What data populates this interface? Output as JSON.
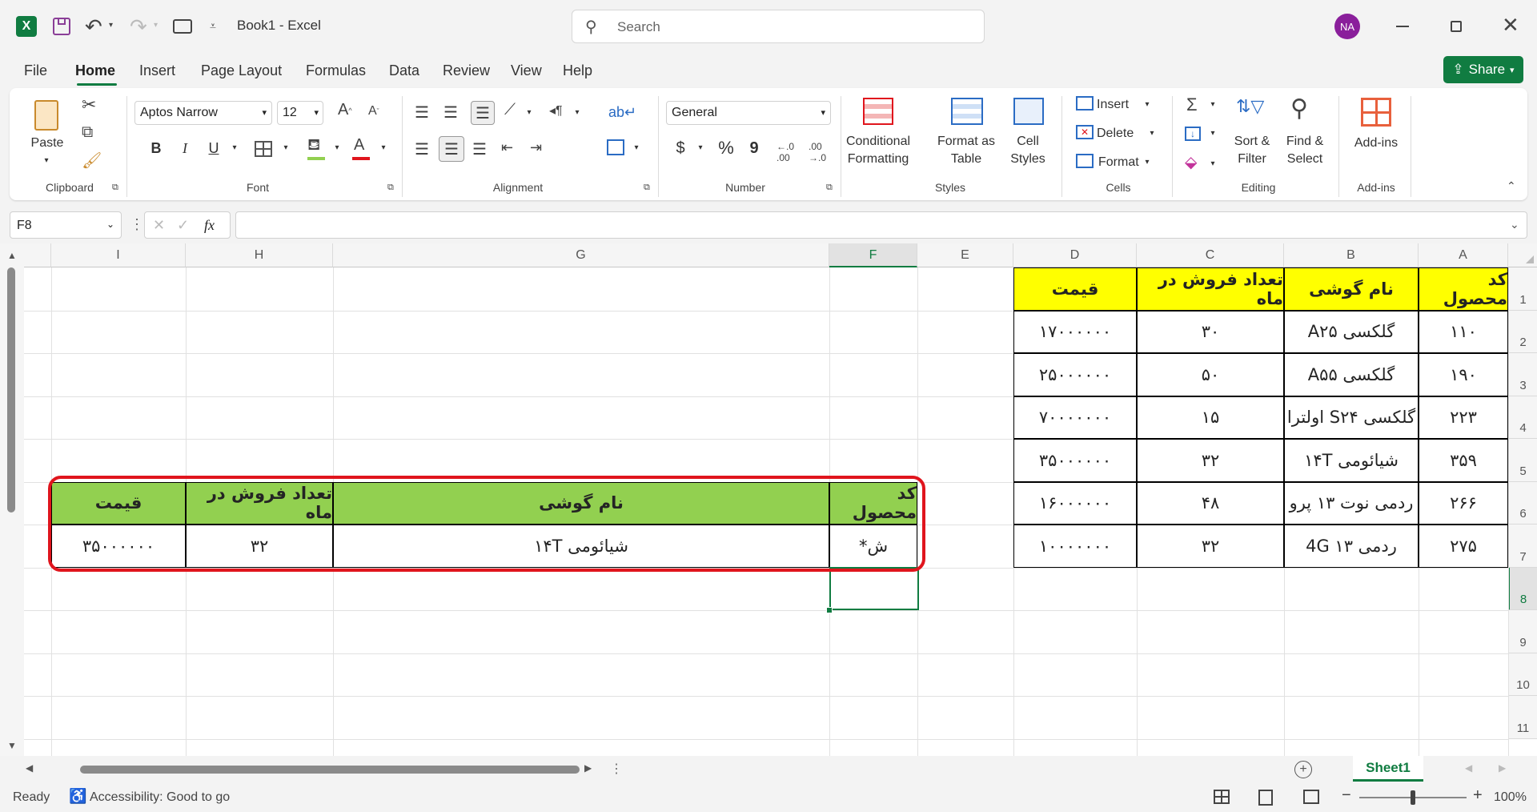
{
  "window": {
    "app_icon": "excel-icon",
    "title": "Book1 - Excel",
    "search_placeholder": "Search",
    "avatar_initials": "NA"
  },
  "menu": {
    "tabs": [
      "File",
      "Home",
      "Insert",
      "Page Layout",
      "Formulas",
      "Data",
      "Review",
      "View",
      "Help"
    ],
    "active": "Home",
    "share_label": "Share"
  },
  "ribbon": {
    "clipboard": {
      "label": "Clipboard",
      "paste": "Paste"
    },
    "font": {
      "label": "Font",
      "family": "Aptos Narrow",
      "size": "12",
      "bold": "B",
      "italic": "I",
      "underline": "U"
    },
    "alignment": {
      "label": "Alignment"
    },
    "number": {
      "label": "Number",
      "format": "General",
      "currency": "$",
      "percent": "%",
      "comma": "9"
    },
    "styles": {
      "label": "Styles",
      "conditional": [
        "Conditional",
        "Formatting"
      ],
      "format_table": [
        "Format as",
        "Table"
      ],
      "cell_styles": [
        "Cell",
        "Styles"
      ]
    },
    "cells": {
      "label": "Cells",
      "insert": "Insert",
      "delete": "Delete",
      "format": "Format"
    },
    "editing": {
      "label": "Editing",
      "sort": [
        "Sort &",
        "Filter"
      ],
      "find": [
        "Find &",
        "Select"
      ]
    },
    "addins": {
      "label": "Add-ins",
      "button": "Add-ins"
    }
  },
  "formula_bar": {
    "name_box": "F8",
    "fx": "fx",
    "value": ""
  },
  "sheet": {
    "columns": [
      "I",
      "H",
      "G",
      "F",
      "E",
      "D",
      "C",
      "B",
      "A"
    ],
    "rows": [
      "1",
      "2",
      "3",
      "4",
      "5",
      "6",
      "7",
      "8",
      "9",
      "10",
      "11"
    ],
    "table1": {
      "headers": [
        "کد محصول",
        "نام گوشی",
        "تعداد فروش در ماه",
        "قیمت"
      ],
      "rows": [
        [
          "۱۱۰",
          "گلکسی A۲۵",
          "۳۰",
          "۱۷۰۰۰۰۰۰"
        ],
        [
          "۱۹۰",
          "گلکسی A۵۵",
          "۵۰",
          "۲۵۰۰۰۰۰۰"
        ],
        [
          "۲۲۳",
          "گلکسی S۲۴ اولترا",
          "۱۵",
          "۷۰۰۰۰۰۰۰"
        ],
        [
          "۳۵۹",
          "شیائومی ۱۴T",
          "۳۲",
          "۳۵۰۰۰۰۰۰"
        ],
        [
          "۲۶۶",
          "ردمی نوت ۱۳ پرو",
          "۴۸",
          "۱۶۰۰۰۰۰۰"
        ],
        [
          "۲۷۵",
          "ردمی ۱۳ 4G",
          "۳۲",
          "۱۰۰۰۰۰۰۰"
        ]
      ]
    },
    "table2": {
      "headers": [
        "کد محصول",
        "نام گوشی",
        "تعداد فروش در ماه",
        "قیمت"
      ],
      "row": [
        "ش*",
        "شیائومی ۱۴T",
        "۳۲",
        "۳۵۰۰۰۰۰۰"
      ]
    }
  },
  "sheet_tab": "Sheet1",
  "status": {
    "ready": "Ready",
    "accessibility": "Accessibility: Good to go",
    "zoom": "100%"
  },
  "colors": {
    "excel_green": "#107c41",
    "yellow": "#ffff00",
    "light_green": "#92d050",
    "highlight_red": "#e0151d"
  }
}
